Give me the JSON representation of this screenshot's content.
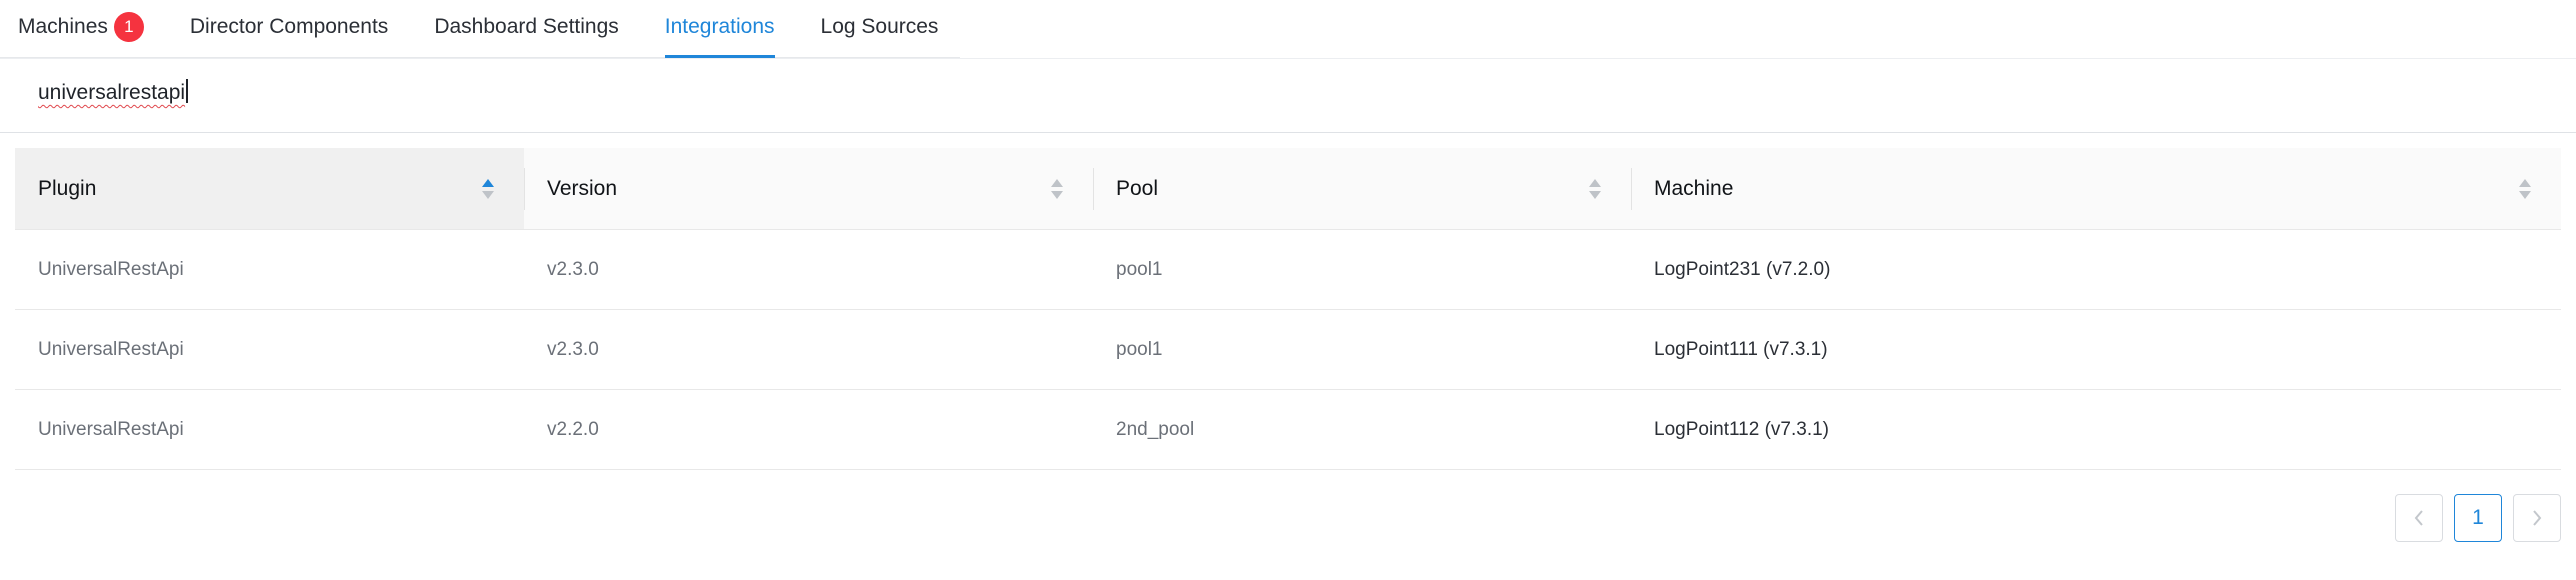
{
  "tabs": [
    {
      "label": "Machines",
      "badge": "1"
    },
    {
      "label": "Director Components"
    },
    {
      "label": "Dashboard Settings"
    },
    {
      "label": "Integrations",
      "active": true
    },
    {
      "label": "Log Sources"
    }
  ],
  "search": {
    "value": "universalrestapi"
  },
  "table": {
    "columns": [
      "Plugin",
      "Version",
      "Pool",
      "Machine"
    ],
    "sorted_column": "Plugin",
    "sort_direction": "ascending",
    "rows": [
      {
        "plugin": "UniversalRestApi",
        "version": "v2.3.0",
        "pool": "pool1",
        "machine": "LogPoint231 (v7.2.0)"
      },
      {
        "plugin": "UniversalRestApi",
        "version": "v2.3.0",
        "pool": "pool1",
        "machine": "LogPoint111 (v7.3.1)"
      },
      {
        "plugin": "UniversalRestApi",
        "version": "v2.2.0",
        "pool": "2nd_pool",
        "machine": "LogPoint112 (v7.3.1)"
      }
    ]
  },
  "pagination": {
    "current_page": "1",
    "prev_icon": "chevron-left-icon",
    "next_icon": "chevron-right-icon"
  },
  "colors": {
    "accent": "#1f86d9",
    "badge": "#f5333f"
  }
}
